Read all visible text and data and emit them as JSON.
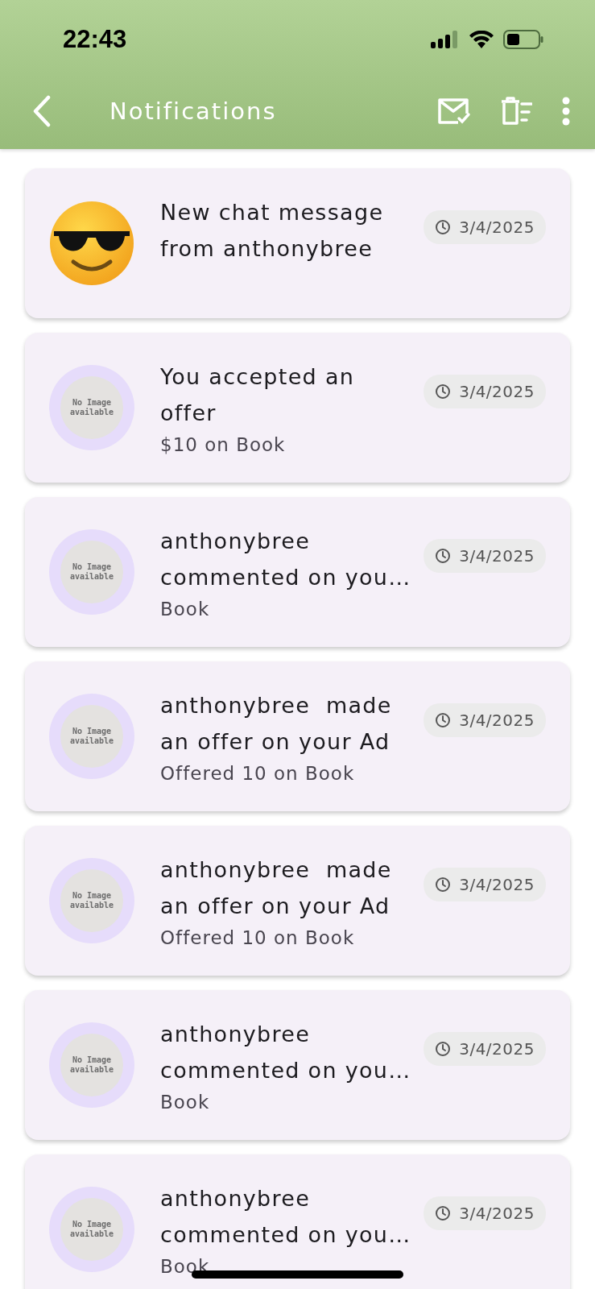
{
  "status_bar": {
    "time": "22:43"
  },
  "app_bar": {
    "title": "Notifications"
  },
  "notifications": [
    {
      "avatar": {
        "kind": "emoji"
      },
      "title": "New chat message from anthonybree",
      "date": "3/4/2025"
    },
    {
      "avatar": {
        "kind": "placeholder",
        "text": [
          "No Image",
          "available"
        ]
      },
      "title": "You accepted an offer",
      "subtitle": "$10 on Book",
      "date": "3/4/2025"
    },
    {
      "avatar": {
        "kind": "placeholder",
        "text": [
          "No Image",
          "available"
        ]
      },
      "title": "anthonybree commented on you…",
      "subtitle": "Book",
      "date": "3/4/2025"
    },
    {
      "avatar": {
        "kind": "placeholder",
        "text": [
          "No Image",
          "available"
        ]
      },
      "title": "anthonybree  made an offer on your Ad",
      "subtitle": "Offered 10 on Book",
      "date": "3/4/2025"
    },
    {
      "avatar": {
        "kind": "placeholder",
        "text": [
          "No Image",
          "available"
        ]
      },
      "title": "anthonybree  made an offer on your Ad",
      "subtitle": "Offered 10 on Book",
      "date": "3/4/2025"
    },
    {
      "avatar": {
        "kind": "placeholder",
        "text": [
          "No Image",
          "available"
        ]
      },
      "title": "anthonybree commented on you…",
      "subtitle": "Book",
      "date": "3/4/2025"
    },
    {
      "avatar": {
        "kind": "placeholder",
        "text": [
          "No Image",
          "available"
        ]
      },
      "title": "anthonybree commented on you…",
      "subtitle": "Book",
      "date": "3/4/2025"
    }
  ]
}
